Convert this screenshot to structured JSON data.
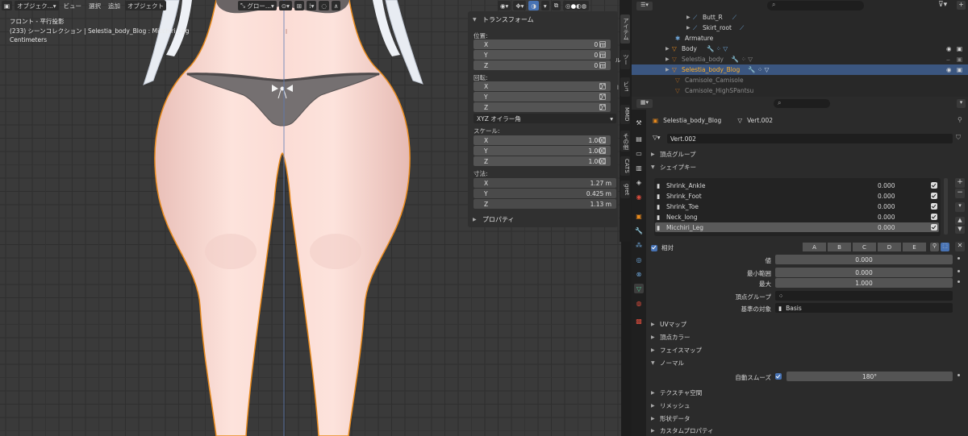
{
  "viewport": {
    "header": {
      "mode": "オブジェク...",
      "menus": [
        "ビュー",
        "選択",
        "追加",
        "オブジェクト"
      ],
      "orientation": "グロー..."
    },
    "overlay": {
      "view_name": "フロント - 平行投影",
      "collection": "(233) シーンコレクション | Selestia_body_Blog : Micchiri_Leg",
      "units": "Centimeters"
    }
  },
  "npanel": {
    "transform_title": "トランスフォーム",
    "location_label": "位置:",
    "location": [
      {
        "axis": "X",
        "value": "0 m"
      },
      {
        "axis": "Y",
        "value": "0 m"
      },
      {
        "axis": "Z",
        "value": "0 m"
      }
    ],
    "rotation_label": "回転:",
    "rotation": [
      {
        "axis": "X",
        "value": "0°"
      },
      {
        "axis": "Y",
        "value": "0°"
      },
      {
        "axis": "Z",
        "value": "0°"
      }
    ],
    "rotation_mode": "XYZ オイラー角",
    "scale_label": "スケール:",
    "scale": [
      {
        "axis": "X",
        "value": "1.000"
      },
      {
        "axis": "Y",
        "value": "1.000"
      },
      {
        "axis": "Z",
        "value": "1.000"
      }
    ],
    "dimensions_label": "寸法:",
    "dimensions": [
      {
        "axis": "X",
        "value": "1.27 m"
      },
      {
        "axis": "Y",
        "value": "0.425 m"
      },
      {
        "axis": "Z",
        "value": "1.13 m"
      }
    ],
    "properties_title": "プロパティ"
  },
  "side_tabs": [
    "アイテム",
    "ツール",
    "ビュー",
    "MMD",
    "その他",
    "CATS",
    "gret"
  ],
  "outliner": {
    "rows": [
      {
        "name": "Butt_R",
        "indent": 3
      },
      {
        "name": "Skirt_root",
        "indent": 3
      },
      {
        "name": "Armature",
        "indent": 2
      },
      {
        "name": "Body",
        "indent": 2
      },
      {
        "name": "Selestia_body",
        "indent": 2
      },
      {
        "name": "Selestia_body_Blog",
        "indent": 2
      },
      {
        "name": "Camisole_Camisole",
        "indent": 2
      },
      {
        "name": "Camisole_HighSPantsu",
        "indent": 2
      }
    ]
  },
  "properties": {
    "object_name": "Selestia_body_Blog",
    "mesh_name": "Vert.002",
    "mesh_field": "Vert.002",
    "sections": {
      "vertex_groups": "頂点グループ",
      "shape_keys": "シェイプキー",
      "uv_maps": "UVマップ",
      "vertex_colors": "頂点カラー",
      "face_maps": "フェイスマップ",
      "normals": "ノーマル",
      "texture_space": "テクスチャ空間",
      "remesh": "リメッシュ",
      "shape_data": "形状データ",
      "custom_props": "カスタムプロパティ"
    },
    "shape_keys": [
      {
        "name": "Shrink_Ankle",
        "value": "0.000"
      },
      {
        "name": "Shrink_Foot",
        "value": "0.000"
      },
      {
        "name": "Shrink_Toe",
        "value": "0.000"
      },
      {
        "name": "Neck_long",
        "value": "0.000"
      },
      {
        "name": "Micchiri_Leg",
        "value": "0.000"
      }
    ],
    "relative_label": "相対",
    "abcde": [
      "A",
      "B",
      "C",
      "D",
      "E"
    ],
    "value_label": "値",
    "value": "0.000",
    "range_min_label": "最小範囲",
    "range_min": "0.000",
    "max_label": "最大",
    "max": "1.000",
    "vgroup_label": "頂点グループ",
    "relative_to_label": "基準の対象",
    "relative_to": "Basis",
    "auto_smooth_label": "自動スムーズ",
    "auto_smooth_angle": "180°"
  },
  "colors": {
    "selection": "#3b5680",
    "accent": "#4772b3",
    "object_outline": "#e88a1d"
  }
}
